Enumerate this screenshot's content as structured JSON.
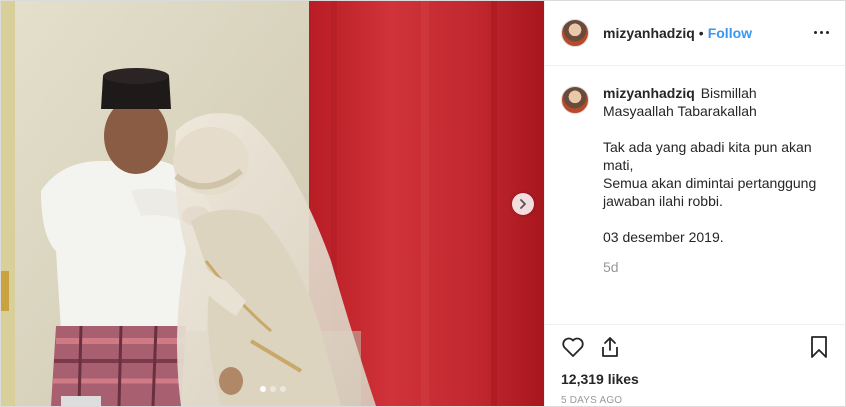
{
  "post": {
    "username": "mizyanhadziq",
    "separator": "•",
    "follow_label": "Follow",
    "caption_lines": [
      "Bismillah",
      "Masyaallah Tabarakallah"
    ],
    "caption_paragraph_2": [
      "Tak ada yang abadi kita pun akan mati,",
      "Semua akan dimintai pertanggung jawaban ilahi robbi."
    ],
    "caption_date": "03 desember 2019.",
    "comment_time": "5d",
    "likes_text": "12,319 likes",
    "posted_ago": "5 days ago",
    "carousel": {
      "slides": 3,
      "active_index": 0
    }
  },
  "icons": {
    "like": "heart-icon",
    "share": "share-icon",
    "save": "bookmark-icon",
    "more": "more-options-icon",
    "next": "chevron-right-icon"
  },
  "colors": {
    "link": "#3897f0",
    "text": "#262626",
    "muted": "#999999",
    "curtain": "#c4262c"
  }
}
